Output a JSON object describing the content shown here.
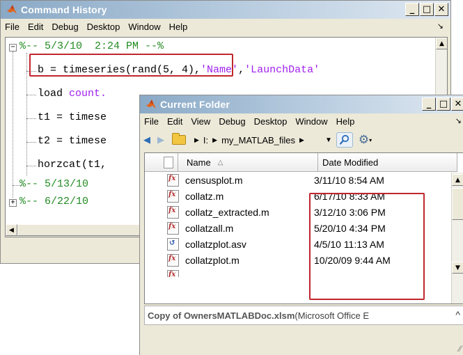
{
  "command_history": {
    "title": "Command History",
    "menu": [
      "File",
      "Edit",
      "Debug",
      "Desktop",
      "Window",
      "Help"
    ],
    "lines": {
      "session1": "%-- 5/3/10  2:24 PM --%",
      "cmd1_prefix": "b = timeseries(rand(5, 4),",
      "cmd1_str1": "'Name'",
      "cmd1_comma": ",",
      "cmd1_str2": "'LaunchData'",
      "cmd2_prefix": "load ",
      "cmd2_rest": "count.",
      "cmd3": "t1 = timese",
      "cmd4": "t2 = timese",
      "cmd5": "horzcat(t1,",
      "session2": "%-- 5/13/10",
      "session3": "%-- 6/22/10"
    }
  },
  "current_folder": {
    "title": "Current Folder",
    "menu": [
      "File",
      "Edit",
      "View",
      "Debug",
      "Desktop",
      "Window",
      "Help"
    ],
    "address": {
      "drive": "I:",
      "folder": "my_MATLAB_files"
    },
    "columns": {
      "name": "Name",
      "sort_indicator": "△",
      "date": "Date Modified"
    },
    "files": [
      {
        "name": "censusplot.m",
        "date": "3/11/10 8:54 AM",
        "icon": "matlab-function-icon"
      },
      {
        "name": "collatz.m",
        "date": "6/17/10 8:33 AM",
        "icon": "matlab-function-icon"
      },
      {
        "name": "collatz_extracted.m",
        "date": "3/12/10 3:06 PM",
        "icon": "matlab-function-icon"
      },
      {
        "name": "collatzall.m",
        "date": "5/20/10 4:34 PM",
        "icon": "matlab-function-icon"
      },
      {
        "name": "collatzplot.asv",
        "date": "4/5/10 11:13 AM",
        "icon": "asv-file-icon"
      },
      {
        "name": "collatzplot.m",
        "date": "10/20/09 9:44 AM",
        "icon": "matlab-function-icon"
      }
    ],
    "status": {
      "file": "Copy of OwnersMATLABDoc.xlsm",
      "detail": " (Microsoft Office E"
    }
  },
  "colors": {
    "highlight_box": "#c0262d",
    "comment_green": "#228b22",
    "string_purple": "#a020f0"
  }
}
